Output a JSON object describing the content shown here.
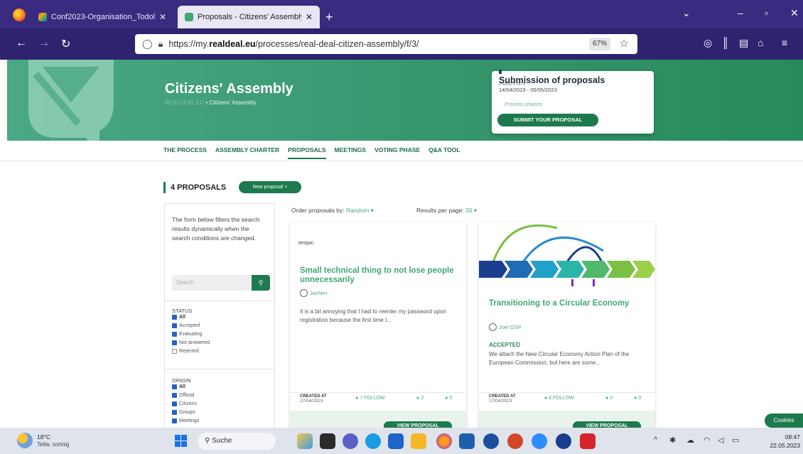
{
  "browser": {
    "tabs": [
      {
        "label": "Conf2023-Organisation_Todolis",
        "active": false
      },
      {
        "label": "Proposals - Citizens' Assembly",
        "active": true
      }
    ],
    "url_prefix": "https://my.",
    "url_domain": "realdeal.eu",
    "url_path": "/processes/real-deal-citizen-assembly/f/3/",
    "zoom": "67%"
  },
  "hero": {
    "title": "Citizens' Assembly",
    "breadcrumb_faint": "REALDEAL.EU",
    "breadcrumb": "Citizens' Assembly",
    "phase_small": "PHASE 1 OF 4",
    "phase_name": "Submission of proposals",
    "phase_dates": "14/04/2023 - 05/05/2023",
    "phase_link": "Process phases",
    "submit_label": "SUBMIT YOUR PROPOSAL"
  },
  "subnav": [
    "THE PROCESS",
    "ASSEMBLY CHARTER",
    "PROPOSALS",
    "MEETINGS",
    "VOTING PHASE",
    "Q&A TOOL"
  ],
  "proposals": {
    "count_label": "4 PROPOSALS",
    "new_label": "New proposal +",
    "order_label": "Order proposals by:",
    "order_value": "Random",
    "perpage_label": "Results per page:",
    "perpage_value": "20"
  },
  "filters": {
    "intro": "The form below filters the search results dynamically when the search conditions are changed.",
    "search_placeholder": "Search",
    "status_head": "STATUS",
    "status": [
      {
        "label": "All",
        "checked": true
      },
      {
        "label": "Accepted",
        "checked": true
      },
      {
        "label": "Evaluating",
        "checked": true
      },
      {
        "label": "Not answered",
        "checked": true
      },
      {
        "label": "Rejected",
        "checked": false
      }
    ],
    "origin_head": "ORIGIN",
    "origin": [
      {
        "label": "All",
        "checked": true
      },
      {
        "label": "Official",
        "checked": true
      },
      {
        "label": "Citizens",
        "checked": true
      },
      {
        "label": "Groups",
        "checked": true
      },
      {
        "label": "Meetings",
        "checked": true
      }
    ]
  },
  "cards": [
    {
      "tag": "testpic",
      "title": "Small technical thing to not lose people unnecessarily",
      "author": "Jochen",
      "body": "It is a bit annoying that I had to reenter my password upon registration because the first time I...",
      "status": "",
      "created_label": "CREATED AT",
      "created": "27/04/2023",
      "follow": "7 FOLLOW",
      "c1": "0",
      "c2": "0",
      "view": "VIEW PROPOSAL"
    },
    {
      "tag": "",
      "title": "Transitioning to a Circular Economy",
      "author": "Joel OSP",
      "body": "We attach the New Circular Economy Action Plan of the European Commission, but here are some...",
      "status": "ACCEPTED",
      "created_label": "CREATED AT",
      "created": "17/04/2023",
      "follow": "6 FOLLOW",
      "c1": "0",
      "c2": "0",
      "view": "VIEW PROPOSAL"
    }
  ],
  "cookies_label": "Cookies",
  "taskbar": {
    "temp": "18°C",
    "weather": "Teilw. sonnig",
    "search": "Suche",
    "time": "08:47",
    "date": "22.05.2023"
  }
}
